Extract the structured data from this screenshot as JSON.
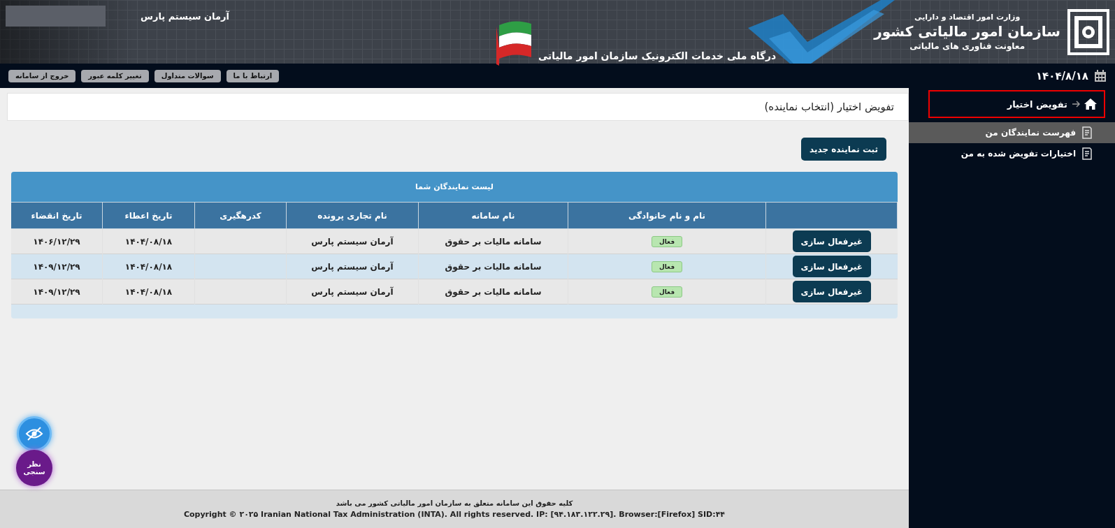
{
  "header": {
    "user_name": "آرمان سیستم پارس",
    "ministry": "وزارت امور اقتصاد و دارایی",
    "organization": "سازمان امور مالیاتی کشور",
    "deputy": "معاونت فناوری های مالیاتی",
    "portal_title": "درگاه ملی خدمات الکترونیک سازمان امور مالیاتی"
  },
  "nav": {
    "date": "۱۴۰۴/۸/۱۸",
    "links": [
      "ارتباط با ما",
      "سوالات متداول",
      "تغییر کلمه عبور",
      "خروج از سامانه"
    ]
  },
  "sidebar": {
    "breadcrumb": "تفویض اختیار",
    "items": [
      {
        "label": "فهرست نمایندگان من",
        "selected": true
      },
      {
        "label": "اختیارات تفویض شده به من",
        "selected": false
      }
    ]
  },
  "page_title": "تفویض اختیار (انتخاب نماینده)",
  "new_button": "ثبت نماینده جدید",
  "table": {
    "title": "لیست نمایندگان شما",
    "columns": [
      "",
      "نام و نام خانوادگی",
      "نام سامانه",
      "نام تجاری پرونده",
      "کدرهگیری",
      "تاریخ اعطاء",
      "تاریخ انقضاء"
    ],
    "rows": [
      {
        "action": "غیرفعال سازی",
        "status": "فعال",
        "system": "سامانه مالیات بر حقوق",
        "trade_name": "آرمان سیستم پارس",
        "granted": "۱۴۰۴/۰۸/۱۸",
        "expires": "۱۴۰۶/۱۲/۲۹"
      },
      {
        "action": "غیرفعال سازی",
        "status": "فعال",
        "system": "سامانه مالیات بر حقوق",
        "trade_name": "آرمان سیستم پارس",
        "granted": "۱۴۰۴/۰۸/۱۸",
        "expires": "۱۴۰۹/۱۲/۲۹"
      },
      {
        "action": "غیرفعال سازی",
        "status": "فعال",
        "system": "سامانه مالیات بر حقوق",
        "trade_name": "آرمان سیستم پارس",
        "granted": "۱۴۰۴/۰۸/۱۸",
        "expires": "۱۴۰۹/۱۲/۲۹"
      }
    ]
  },
  "survey_button": "نظر سنجی",
  "footer": {
    "rights": "کلیه حقوق این سامانه متعلق به سازمان امور مالیاتی کشور می باشد",
    "copyright": "Copyright © ۲۰۲۵ Iranian National Tax Administration (INTA). All rights reserved. IP: [۹۴.۱۸۳.۱۲۲.۲۹]. Browser:[Firefox] SID:۴۴"
  }
}
